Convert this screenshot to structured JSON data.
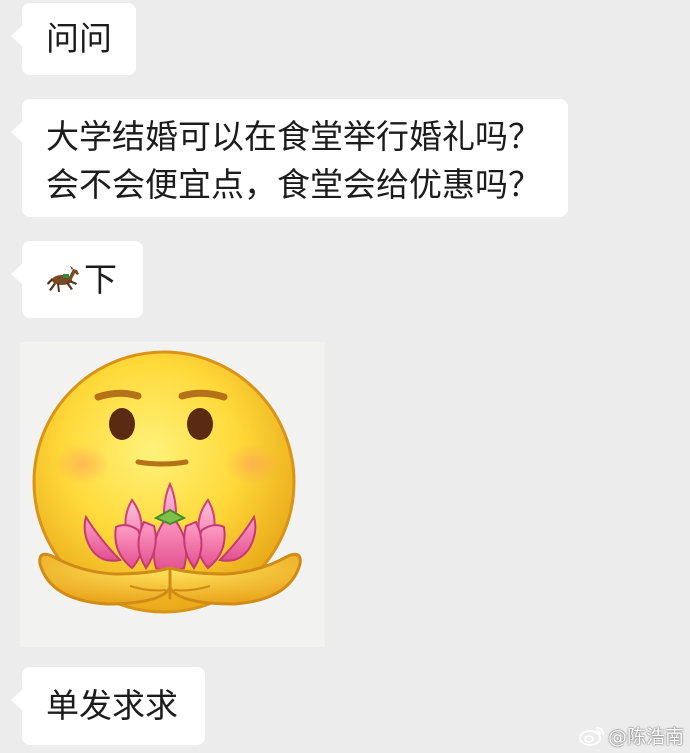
{
  "messages": [
    {
      "type": "text",
      "text": "问问"
    },
    {
      "type": "text",
      "lines": [
        "大学结婚可以在食堂举行婚礼吗？",
        "会不会便宜点，食堂会给优惠吗？"
      ]
    },
    {
      "type": "text",
      "emoji": "horse-emoji",
      "text": "下"
    },
    {
      "type": "sticker",
      "sticker": "smiley-holding-lotus-sticker"
    },
    {
      "type": "text",
      "text": "单发求求"
    }
  ],
  "watermark": {
    "text": "@陈浩南",
    "icon": "weibo-logo-icon"
  },
  "colors": {
    "chat_background": "#ececec",
    "bubble": "#ffffff",
    "text": "#1c1c1c"
  }
}
